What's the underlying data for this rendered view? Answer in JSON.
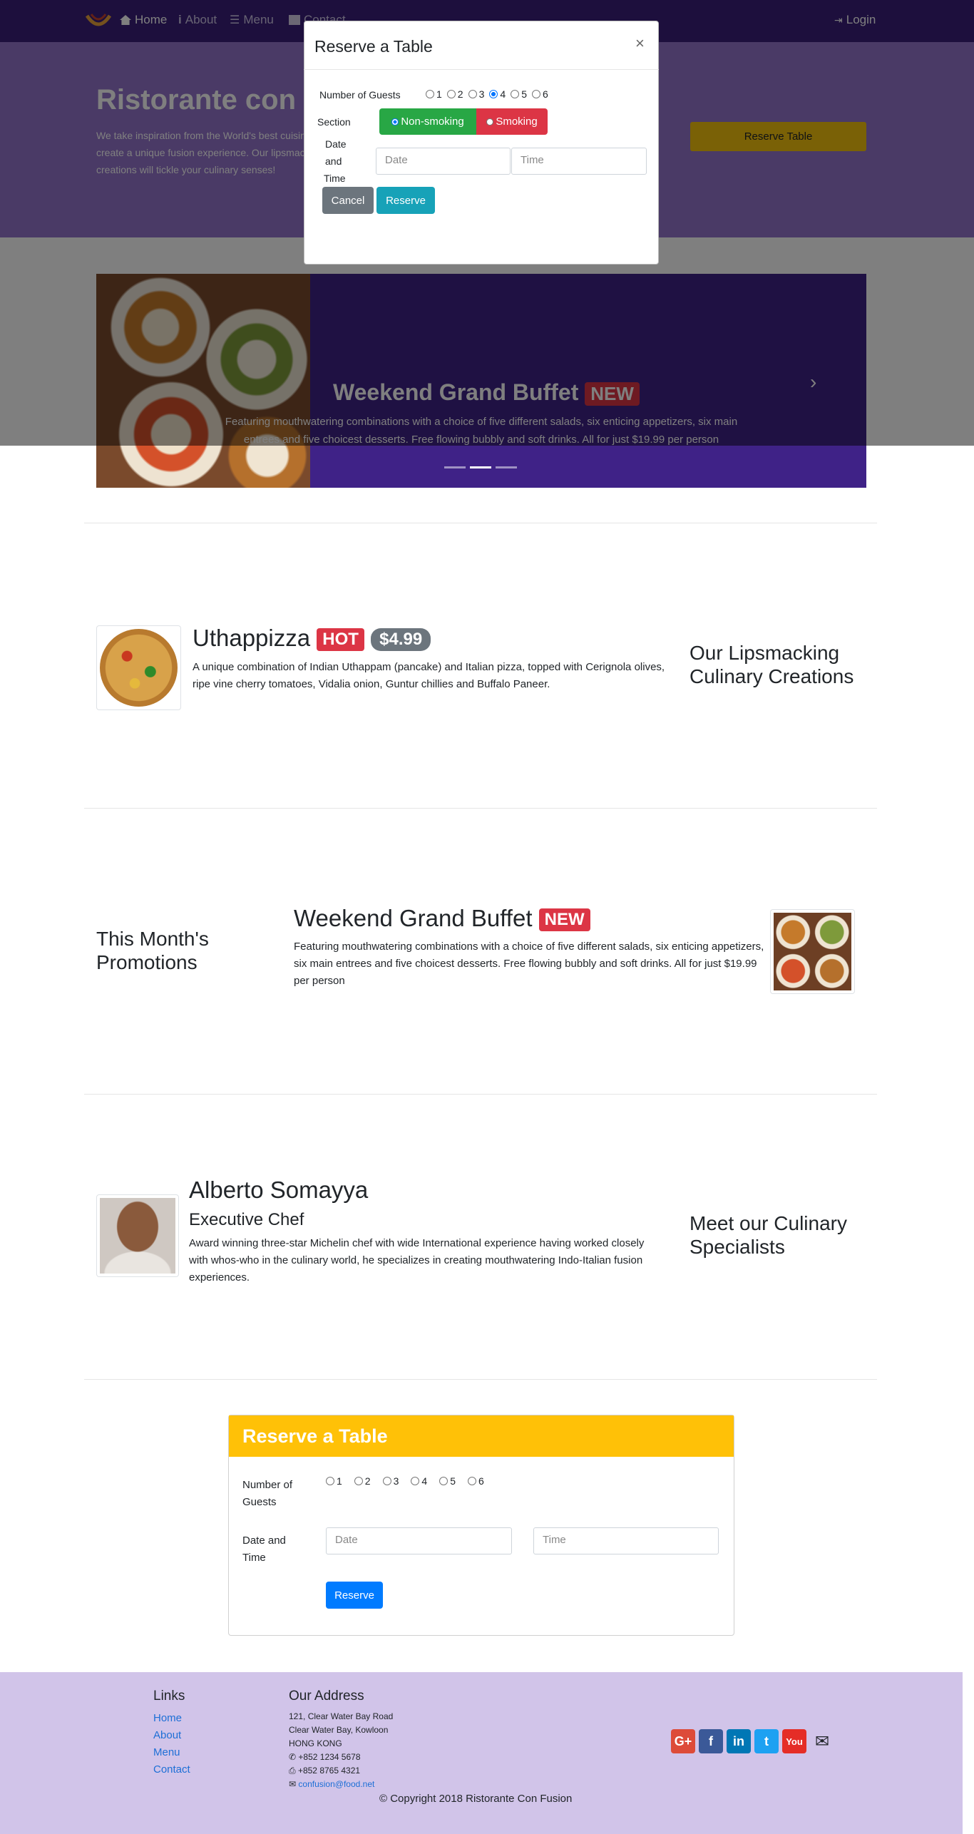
{
  "navbar": {
    "items": [
      {
        "label": "Home",
        "icon": "home-icon"
      },
      {
        "label": "About",
        "icon": "info-icon"
      },
      {
        "label": "Menu",
        "icon": "list-icon"
      },
      {
        "label": "Contact",
        "icon": "address-card-icon"
      }
    ],
    "login_label": "Login"
  },
  "jumbotron": {
    "title": "Ristorante con Fusion",
    "text": "We take inspiration from the World's best cuisines, and create a unique fusion experience. Our lipsmacking creations will tickle your culinary senses!",
    "button_label": "Reserve Table"
  },
  "carousel": {
    "title": "Weekend Grand Buffet",
    "badge": "NEW",
    "text": "Featuring mouthwatering combinations with a choice of five different salads, six enticing appetizers, six main entrees and five choicest desserts. Free flowing bubbly and soft drinks. All for just $19.99 per person",
    "next_glyph": "›",
    "active_indicator": 2
  },
  "modal": {
    "title": "Reserve a Table",
    "close_glyph": "×",
    "guests_label": "Number of Guests",
    "guest_options": [
      "1",
      "2",
      "3",
      "4",
      "5",
      "6"
    ],
    "selected_guests": "4",
    "section_label": "Section",
    "non_smoking_label": "Non-smoking",
    "smoking_label": "Smoking",
    "datetime_label_1": "Date",
    "datetime_label_2": "and",
    "datetime_label_3": "Time",
    "date_placeholder": "Date",
    "time_placeholder": "Time",
    "cancel_label": "Cancel",
    "reserve_label": "Reserve"
  },
  "dish": {
    "title": "Uthappizza",
    "badge": "HOT",
    "price": "$4.99",
    "text": "A unique combination of Indian Uthappam (pancake) and Italian pizza, topped with Cerignola olives, ripe vine cherry tomatoes, Vidalia onion, Guntur chillies and Buffalo Paneer.",
    "side_heading_1": "Our Lipsmacking",
    "side_heading_2": "Culinary Creations"
  },
  "promotion": {
    "side_heading_1": "This Month's",
    "side_heading_2": "Promotions",
    "title": "Weekend Grand Buffet",
    "badge": "NEW",
    "text": "Featuring mouthwatering combinations with a choice of five different salads, six enticing appetizers, six main entrees and five choicest desserts. Free flowing bubbly and soft drinks. All for just $19.99 per person"
  },
  "leader": {
    "name": "Alberto Somayya",
    "role": "Executive Chef",
    "text": "Award winning three-star Michelin chef with wide International experience having worked closely with whos-who in the culinary world, he specializes in creating mouthwatering Indo-Italian fusion experiences.",
    "side_heading_1": "Meet our Culinary",
    "side_heading_2": "Specialists"
  },
  "reserve_card": {
    "title": "Reserve a Table",
    "guests_label_1": "Number of",
    "guests_label_2": "Guests",
    "guest_options": [
      "1",
      "2",
      "3",
      "4",
      "5",
      "6"
    ],
    "datetime_label_1": "Date and",
    "datetime_label_2": "Time",
    "date_placeholder": "Date",
    "time_placeholder": "Time",
    "reserve_label": "Reserve"
  },
  "footer": {
    "links_heading": "Links",
    "links": [
      "Home",
      "About",
      "Menu",
      "Contact"
    ],
    "address_heading": "Our Address",
    "address_line1": "121, Clear Water Bay Road",
    "address_line2": "Clear Water Bay, Kowloon",
    "address_line3": "HONG KONG",
    "phone": "+852 1234 5678",
    "fax": "+852 8765 4321",
    "email": "confusion@food.net",
    "social": [
      "google-plus-icon",
      "facebook-icon",
      "linkedin-icon",
      "twitter-icon",
      "youtube-icon",
      "mail-icon"
    ],
    "copyright": "© Copyright 2018 Ristorante Con Fusion"
  },
  "colors": {
    "navbar": "#3a1e7a",
    "jumbotron": "#9575cd",
    "footer": "#d1c4e9",
    "card_header": "#ffc107"
  }
}
